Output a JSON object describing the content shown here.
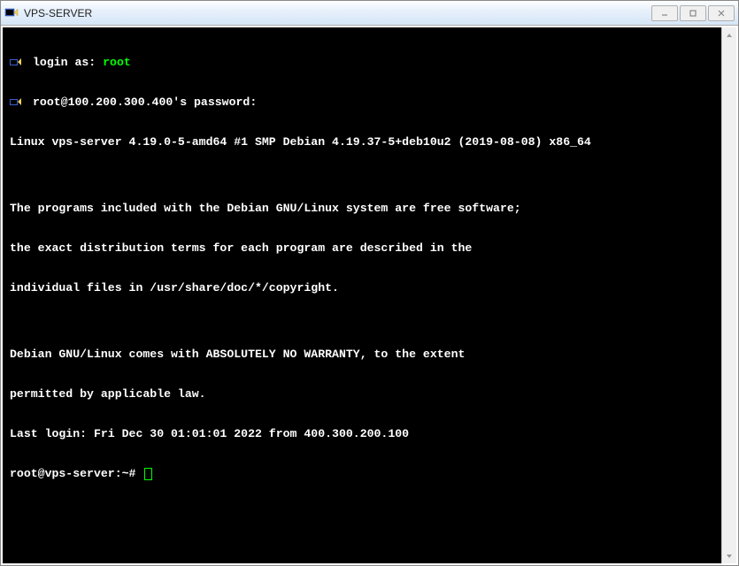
{
  "window": {
    "title": "VPS-SERVER"
  },
  "terminal": {
    "login_prompt": "login as: ",
    "login_user": "root",
    "password_prompt": "root@100.200.300.400's password:",
    "motd_line1": "Linux vps-server 4.19.0-5-amd64 #1 SMP Debian 4.19.37-5+deb10u2 (2019-08-08) x86_64",
    "motd_blank1": "",
    "motd_line2": "The programs included with the Debian GNU/Linux system are free software;",
    "motd_line3": "the exact distribution terms for each program are described in the",
    "motd_line4": "individual files in /usr/share/doc/*/copyright.",
    "motd_blank2": "",
    "motd_line5": "Debian GNU/Linux comes with ABSOLUTELY NO WARRANTY, to the extent",
    "motd_line6": "permitted by applicable law.",
    "last_login": "Last login: Fri Dec 30 01:01:01 2022 from 400.300.200.100",
    "prompt": "root@vps-server:~#"
  }
}
